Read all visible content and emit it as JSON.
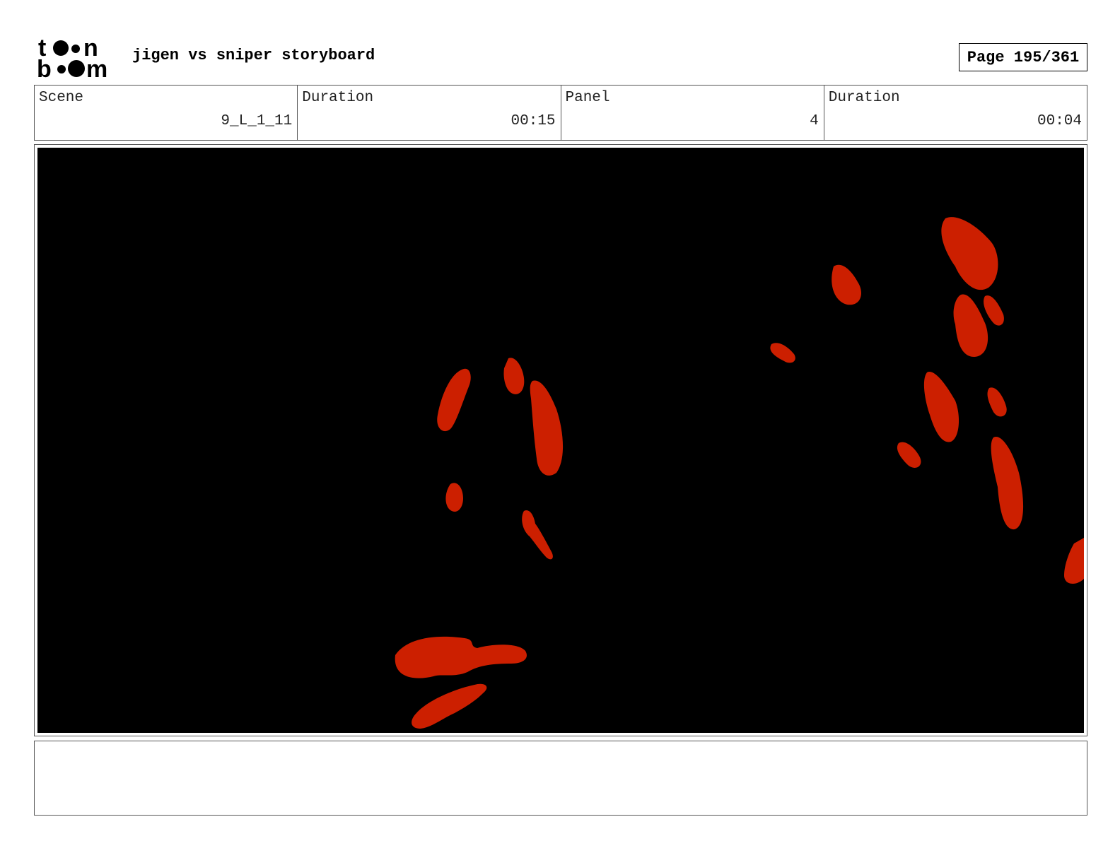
{
  "header": {
    "logo_text": "toon boom",
    "title": "jigen vs sniper storyboard",
    "page_label": "Page 195/361"
  },
  "info": [
    {
      "label": "Scene",
      "value": "9_L_1_11"
    },
    {
      "label": "Duration",
      "value": "00:15"
    },
    {
      "label": "Panel",
      "value": "4"
    },
    {
      "label": "Duration",
      "value": "00:04"
    }
  ],
  "panel": {
    "background_color": "#000000",
    "shape_color": "#cc1f00"
  },
  "notes": {
    "text": ""
  }
}
